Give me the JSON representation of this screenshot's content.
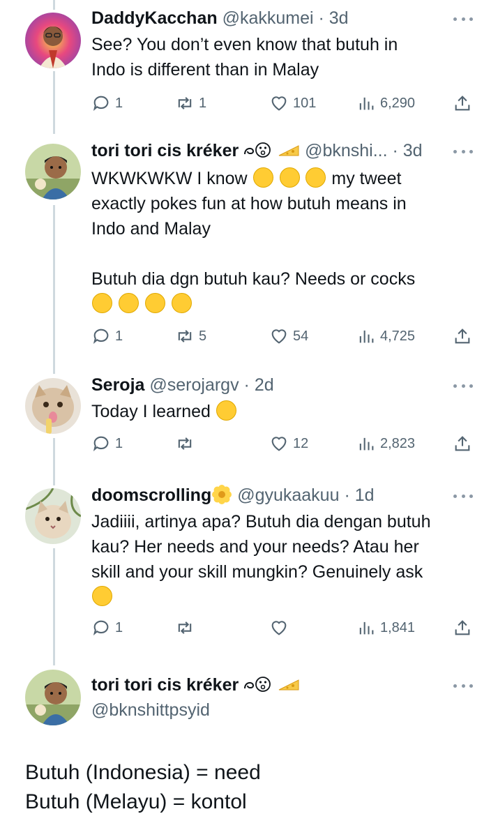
{
  "tweets": [
    {
      "name": "DaddyKacchan",
      "handle": "@kakkumei",
      "dot": " · ",
      "time": "3d",
      "text": "See? You don’t even know that butuh in\nIndo is different than in Malay",
      "replies": "1",
      "retweets": "1",
      "likes": "101",
      "views": "6,290"
    },
    {
      "name": "tori tori cis kréker",
      "handle": "@bknshi...",
      "dot": " · ",
      "time": "3d",
      "text_a": "WKWKWKW I know ",
      "text_b": " my tweet\nexactly pokes fun at how butuh means in\nIndo and Malay\n\nButuh dia dgn butuh kau? Needs or cocks",
      "replies": "1",
      "retweets": "5",
      "likes": "54",
      "views": "4,725"
    },
    {
      "name": "Seroja",
      "handle": "@serojargv",
      "dot": " · ",
      "time": "2d",
      "text": "Today I learned ",
      "replies": "1",
      "retweets": "",
      "likes": "12",
      "views": "2,823"
    },
    {
      "name": "doomscrolling",
      "handle": "@gyukaakuu",
      "dot": " · ",
      "time": "1d",
      "text": "Jadiiii, artinya apa? Butuh dia dengan butuh\nkau? Her needs and your needs? Atau her\nskill and your skill mungkin? Genuinely ask",
      "replies": "1",
      "retweets": "",
      "likes": "",
      "views": "1,841"
    }
  ],
  "main_tweet": {
    "name": "tori tori cis kréker",
    "handle": "@bknshittpsyid",
    "line1": "Butuh (Indonesia) = need",
    "line2": "Butuh (Melayu) = kontol"
  },
  "icons": {
    "reply": "reply-icon",
    "retweet": "retweet-icon",
    "like": "heart-icon",
    "views": "views-icon",
    "share": "share-icon",
    "more": "more-icon"
  },
  "colors": {
    "text": "#0f1419",
    "secondary": "#536471",
    "thread_line": "#cfd9de",
    "emoji": "#ffcc33"
  }
}
